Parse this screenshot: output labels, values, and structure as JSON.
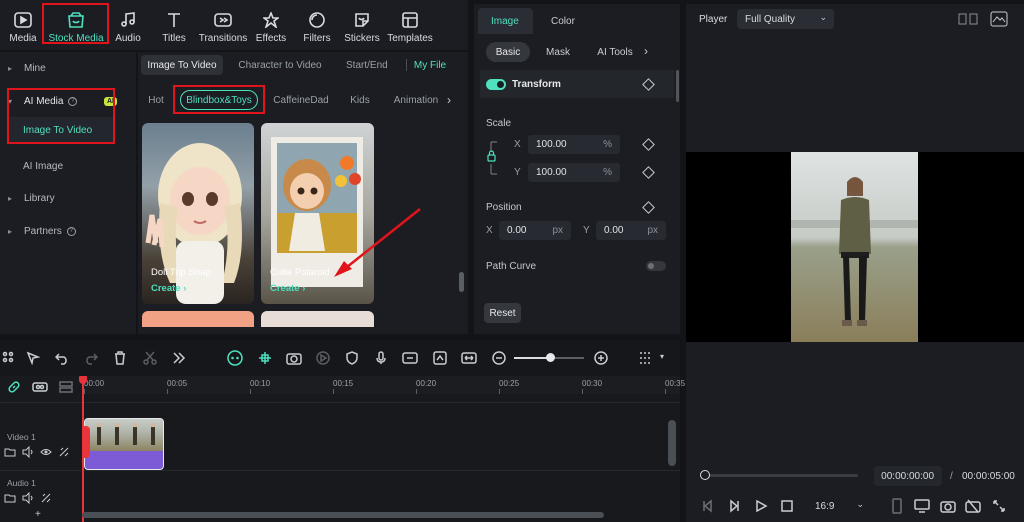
{
  "toolbar": {
    "items": [
      {
        "label": "Media",
        "icon": "media-icon"
      },
      {
        "label": "Stock Media",
        "icon": "stock-media-icon"
      },
      {
        "label": "Audio",
        "icon": "music-note-icon"
      },
      {
        "label": "Titles",
        "icon": "text-t-icon"
      },
      {
        "label": "Transitions",
        "icon": "transitions-icon"
      },
      {
        "label": "Effects",
        "icon": "effects-icon"
      },
      {
        "label": "Filters",
        "icon": "filters-icon"
      },
      {
        "label": "Stickers",
        "icon": "stickers-icon"
      },
      {
        "label": "Templates",
        "icon": "templates-icon"
      }
    ],
    "active": "Stock Media"
  },
  "sidebar": {
    "items": [
      {
        "label": "Mine"
      },
      {
        "label": "AI Media",
        "badge": "AI"
      },
      {
        "label": "Image To Video"
      },
      {
        "label": "AI Image"
      },
      {
        "label": "Library"
      },
      {
        "label": "Partners"
      }
    ]
  },
  "library": {
    "tabs": [
      "Image To Video",
      "Character to Video",
      "Start/End",
      "My File"
    ],
    "categories": [
      "Hot",
      "Blindbox&Toys",
      "CaffeineDad",
      "Kids",
      "Animation"
    ],
    "cards": [
      {
        "title": "Doll Trip Snap",
        "action": "Create"
      },
      {
        "title": "Cutie Polaroid",
        "action": "Create"
      }
    ]
  },
  "inspector": {
    "tabs": [
      "Image",
      "Color"
    ],
    "subtabs": [
      "Basic",
      "Mask",
      "AI Tools"
    ],
    "transform_label": "Transform",
    "scale_label": "Scale",
    "scale_x_axis": "X",
    "scale_x": "100.00",
    "scale_y_axis": "Y",
    "scale_y": "100.00",
    "percent": "%",
    "position_label": "Position",
    "pos_x_axis": "X",
    "pos_x": "0.00",
    "pos_y_axis": "Y",
    "pos_y": "0.00",
    "px": "px",
    "path_curve_label": "Path Curve",
    "reset_label": "Reset"
  },
  "player": {
    "label": "Player",
    "quality": "Full Quality",
    "current_time": "00:00:00:00",
    "separator": "/",
    "total_time": "00:00:05:00",
    "aspect": "16:9"
  },
  "timeline": {
    "ruler": [
      "00:00",
      "00:05",
      "00:10",
      "00:15",
      "00:20",
      "00:25",
      "00:30",
      "00:35"
    ],
    "tracks": [
      {
        "label": "Video 1"
      },
      {
        "label": "Audio 1"
      }
    ]
  },
  "colors": {
    "accent": "#4fe0c0",
    "highlight": "#e0141a",
    "clip": "#7e5bd6"
  }
}
